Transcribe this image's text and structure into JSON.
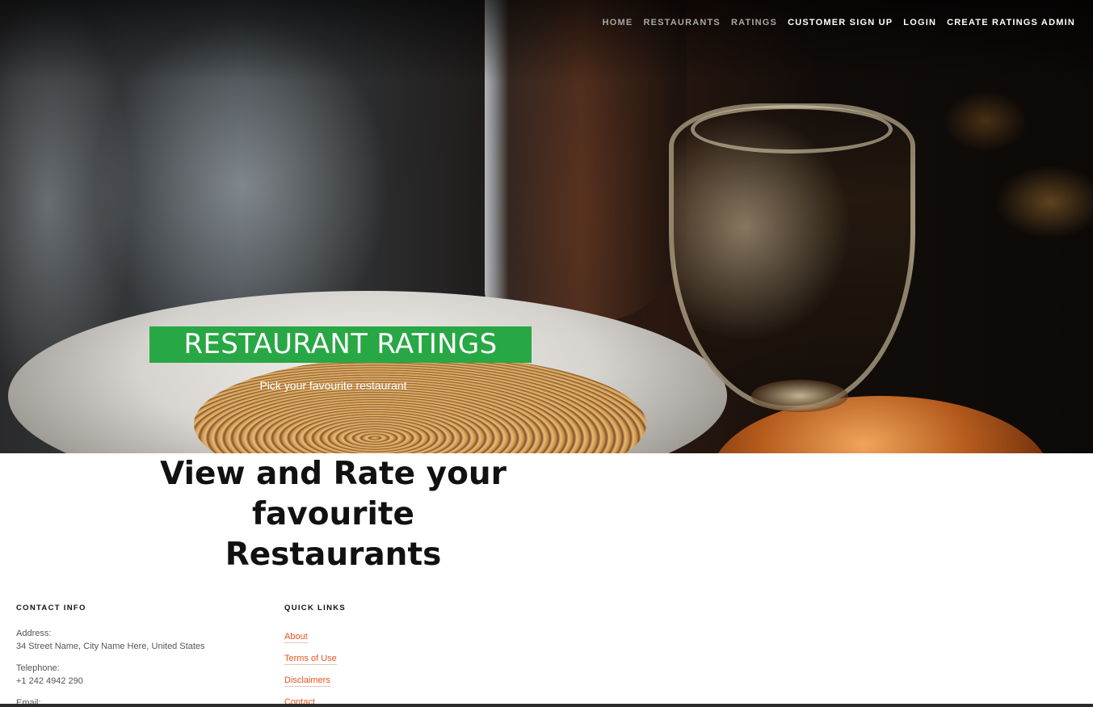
{
  "nav": {
    "items": [
      {
        "label": "HOME",
        "active": false
      },
      {
        "label": "RESTAURANTS",
        "active": false
      },
      {
        "label": "RATINGS",
        "active": false
      },
      {
        "label": "CUSTOMER SIGN UP",
        "active": true
      },
      {
        "label": "LOGIN",
        "active": true
      },
      {
        "label": "CREATE RATINGS ADMIN",
        "active": true
      }
    ]
  },
  "hero": {
    "title": "RESTAURANT RATINGS",
    "subtitle": "Pick your favourite restaurant",
    "title_bg_color": "#28a745"
  },
  "main": {
    "heading_line1": "View and Rate your favourite",
    "heading_line2": "Restaurants"
  },
  "footer": {
    "contact": {
      "heading": "CONTACT INFO",
      "address_label": "Address:",
      "address_value": "34 Street Name, City Name Here, United States",
      "telephone_label": "Telephone:",
      "telephone_value": "+1 242 4942 290",
      "email_label": "Email:"
    },
    "quick_links": {
      "heading": "QUICK LINKS",
      "items": [
        "About",
        "Terms of Use",
        "Disclaimers",
        "Contact"
      ],
      "link_color": "#e8541c"
    }
  }
}
